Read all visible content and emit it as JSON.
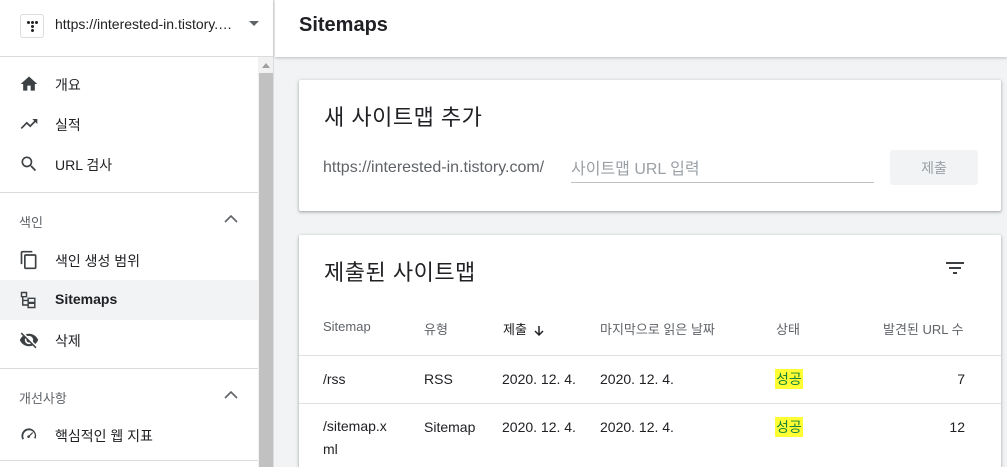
{
  "property": {
    "url": "https://interested-in.tistory.c..."
  },
  "nav": {
    "items": [
      {
        "label": "개요",
        "icon": "home-icon"
      },
      {
        "label": "실적",
        "icon": "trending-up-icon"
      },
      {
        "label": "URL 검사",
        "icon": "search-icon"
      }
    ],
    "sections": [
      {
        "label": "색인",
        "items": [
          {
            "label": "색인 생성 범위",
            "icon": "copy-icon"
          },
          {
            "label": "Sitemaps",
            "icon": "sitemap-icon",
            "active": true
          },
          {
            "label": "삭제",
            "icon": "visibility-off-icon"
          }
        ]
      },
      {
        "label": "개선사항",
        "items": [
          {
            "label": "핵심적인 웹 지표",
            "icon": "speed-gauge-icon"
          }
        ]
      }
    ]
  },
  "header": {
    "title": "Sitemaps"
  },
  "add_sitemap": {
    "title": "새 사이트맵 추가",
    "prefix": "https://interested-in.tistory.com/",
    "placeholder": "사이트맵 URL 입력",
    "submit_label": "제출"
  },
  "submitted": {
    "title": "제출된 사이트맵",
    "columns": [
      "Sitemap",
      "유형",
      "제출",
      "마지막으로 읽은 날짜",
      "상태",
      "발견된 URL 수"
    ],
    "rows": [
      {
        "sitemap": "/rss",
        "type": "RSS",
        "submitted": "2020. 12. 4.",
        "last_read": "2020. 12. 4.",
        "status": "성공",
        "urls": "7"
      },
      {
        "sitemap": "/sitemap.xml",
        "type": "Sitemap",
        "submitted": "2020. 12. 4.",
        "last_read": "2020. 12. 4.",
        "status": "성공",
        "urls": "12"
      }
    ]
  },
  "colors": {
    "status_success": "#188038",
    "highlight": "#ffff33"
  }
}
